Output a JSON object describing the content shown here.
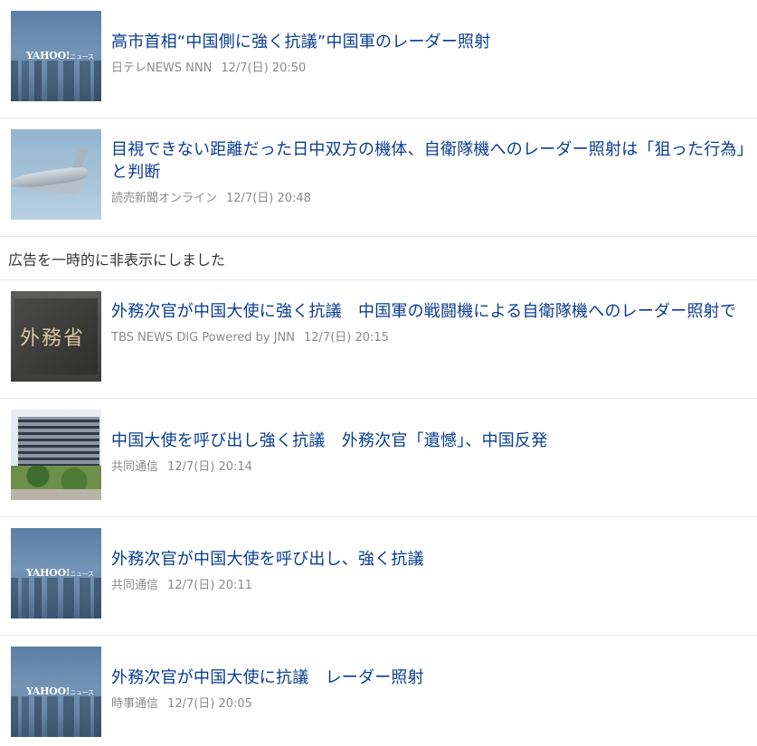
{
  "articles": [
    {
      "title": "高市首相“中国側に強く抗議”中国軍のレーダー照射",
      "source": "日テレNEWS NNN",
      "time": "12/7(日) 20:50",
      "thumb": "yahoo-news-logo"
    },
    {
      "title": "目視できない距離だった日中双方の機体、自衛隊機へのレーダー照射は「狙った行為」と判断",
      "source": "読売新聞オンライン",
      "time": "12/7(日) 20:48",
      "thumb": "fighter-jet-photo"
    },
    {
      "title": "外務次官が中国大使に強く抗議　中国軍の戦闘機による自衛隊機へのレーダー照射で",
      "source": "TBS NEWS DIG Powered by JNN",
      "time": "12/7(日) 20:15",
      "thumb": "ministry-sign-photo",
      "thumb_text": "外務省"
    },
    {
      "title": "中国大使を呼び出し強く抗議　外務次官「遺憾」、中国反発",
      "source": "共同通信",
      "time": "12/7(日) 20:14",
      "thumb": "ministry-building-photo"
    },
    {
      "title": "外務次官が中国大使を呼び出し、強く抗議",
      "source": "共同通信",
      "time": "12/7(日) 20:11",
      "thumb": "yahoo-news-logo"
    },
    {
      "title": "外務次官が中国大使に抗議　レーダー照射",
      "source": "時事通信",
      "time": "12/7(日) 20:05",
      "thumb": "yahoo-news-logo"
    }
  ],
  "ad_notice": "広告を一時的に非表示にしました",
  "yahoo_logo": "YAHOO!",
  "yahoo_logo_sub": "ニュース",
  "colors": {
    "title_link": "#0a3d91",
    "meta": "#8b8b8b",
    "divider": "#e8e8e8"
  }
}
